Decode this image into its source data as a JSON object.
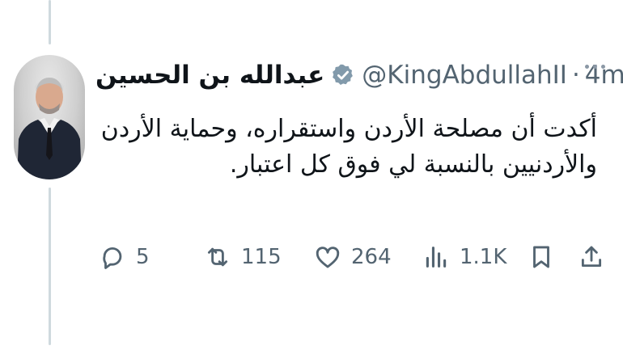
{
  "tweet": {
    "author": {
      "display_name": "عبدالله بن الحسين",
      "handle": "@KingAbdullahII",
      "verified": true
    },
    "separator": "·",
    "time": "4m",
    "text_lines": [
      "أكدت أن مصلحة الأردن واستقراره، وحماية الأردن",
      "والأردنيين بالنسبة لي فوق كل اعتبار."
    ],
    "actions": {
      "replies": "5",
      "reposts": "115",
      "likes": "264",
      "views": "1.1K"
    },
    "icons": {
      "more": "more-horizontal-icon",
      "reply": "reply-icon",
      "repost": "repost-icon",
      "like": "heart-icon",
      "views": "views-chart-icon",
      "bookmark": "bookmark-icon",
      "share": "share-icon"
    },
    "colors": {
      "text": "#0f1419",
      "secondary": "#536471",
      "thread_line": "#cfd9de"
    }
  }
}
